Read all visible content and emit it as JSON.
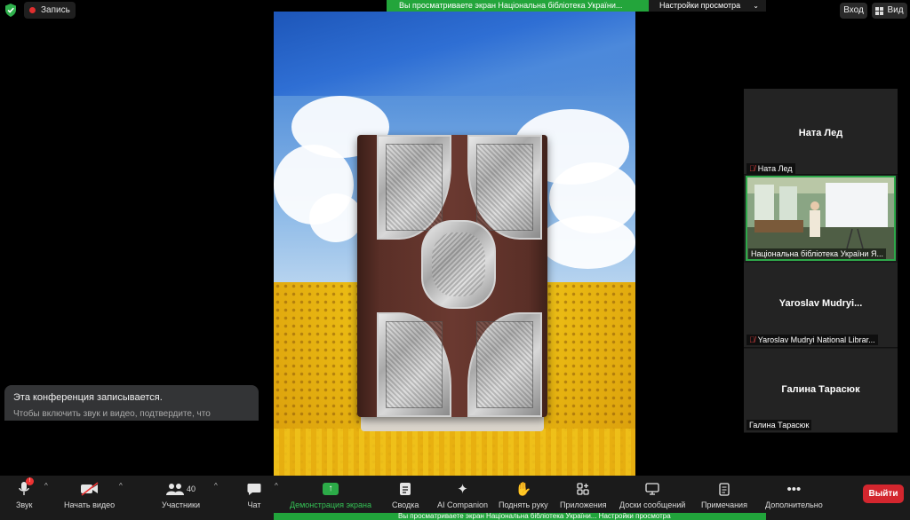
{
  "topbar": {
    "record_label": "Запись",
    "share_banner": "Вы просматриваете экран Національна бібліотека України...",
    "view_settings": "Настройки просмотра",
    "login": "Вход",
    "view": "Вид"
  },
  "participants": [
    {
      "display_name": "Ната Лед",
      "label": "Ната Лед",
      "muted": true
    },
    {
      "display_name": "",
      "label": "Національна бібліотека України Я...",
      "muted": false,
      "active_speaker": true
    },
    {
      "display_name": "Yaroslav  Mudryi...",
      "label": "Yaroslav Mudryi National Librar...",
      "muted": true
    },
    {
      "display_name": "Галина Тарасюк",
      "label": "Галина Тарасюк",
      "muted": false
    }
  ],
  "notice": {
    "title": "Эта конференция записывается.",
    "body": "Чтобы включить звук и видео, подтвердите, что"
  },
  "toolbar": {
    "audio": "Звук",
    "video": "Начать видео",
    "participants": "Участники",
    "participants_count": "40",
    "chat": "Чат",
    "share": "Демонстрация экрана",
    "summary": "Сводка",
    "ai": "AI Companion",
    "raise_hand": "Поднять руку",
    "apps": "Приложения",
    "whiteboards": "Доски сообщений",
    "notes": "Примечания",
    "more": "Дополнительно",
    "leave": "Выйти"
  },
  "bottom_strip": "Вы просматриваете экран Національна бібліотека України...   Настройки просмотра",
  "colors": {
    "share_green": "#23a53b",
    "leave_red": "#d3262e",
    "toolbar_bg": "#1b1b1b",
    "active_border": "#2ea84a"
  }
}
